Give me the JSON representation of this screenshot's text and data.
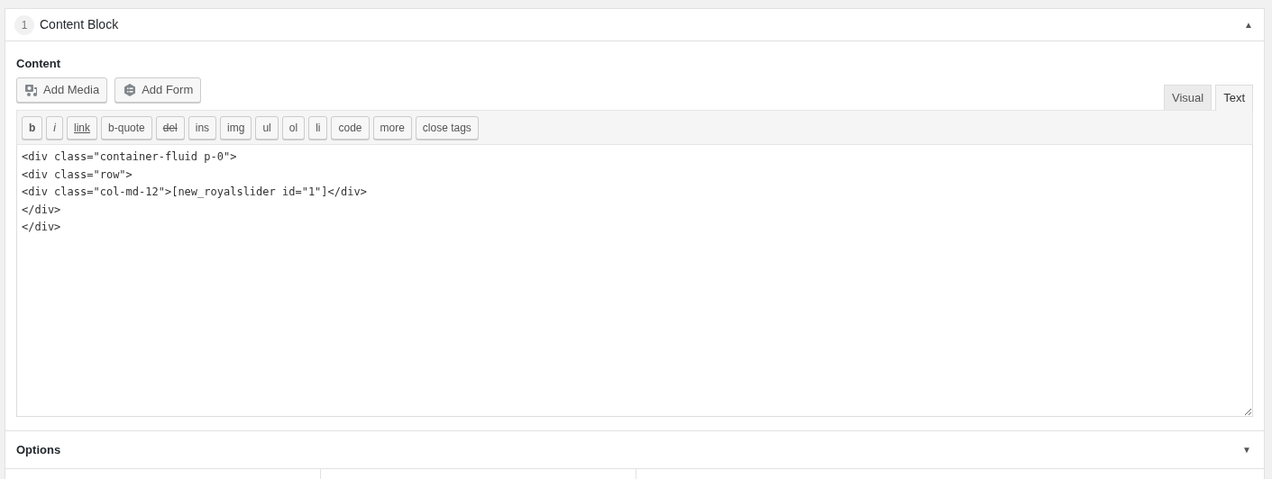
{
  "block": {
    "number": "1",
    "title": "Content Block",
    "toggle": "▲"
  },
  "content": {
    "label": "Content",
    "media_buttons": [
      {
        "label": "Add Media",
        "kind": "media"
      },
      {
        "label": "Add Form",
        "kind": "form"
      }
    ],
    "tabs": [
      {
        "label": "Visual",
        "selected": false
      },
      {
        "label": "Text",
        "selected": true
      }
    ],
    "toolbar": [
      {
        "label": "b",
        "kind": "bold"
      },
      {
        "label": "i",
        "kind": "italic"
      },
      {
        "label": "link",
        "kind": "underline"
      },
      {
        "label": "b-quote",
        "kind": "plain"
      },
      {
        "label": "del",
        "kind": "strike"
      },
      {
        "label": "ins",
        "kind": "plain"
      },
      {
        "label": "img",
        "kind": "plain"
      },
      {
        "label": "ul",
        "kind": "plain"
      },
      {
        "label": "ol",
        "kind": "plain"
      },
      {
        "label": "li",
        "kind": "plain"
      },
      {
        "label": "code",
        "kind": "plain"
      },
      {
        "label": "more",
        "kind": "plain"
      },
      {
        "label": "close tags",
        "kind": "plain"
      }
    ],
    "code": "<div class=\"container-fluid p-0\">\n<div class=\"row\">\n<div class=\"col-md-12\">[new_royalslider id=\"1\"]</div>\n</div>\n</div>"
  },
  "options": {
    "title": "Options",
    "toggle": "▼"
  }
}
